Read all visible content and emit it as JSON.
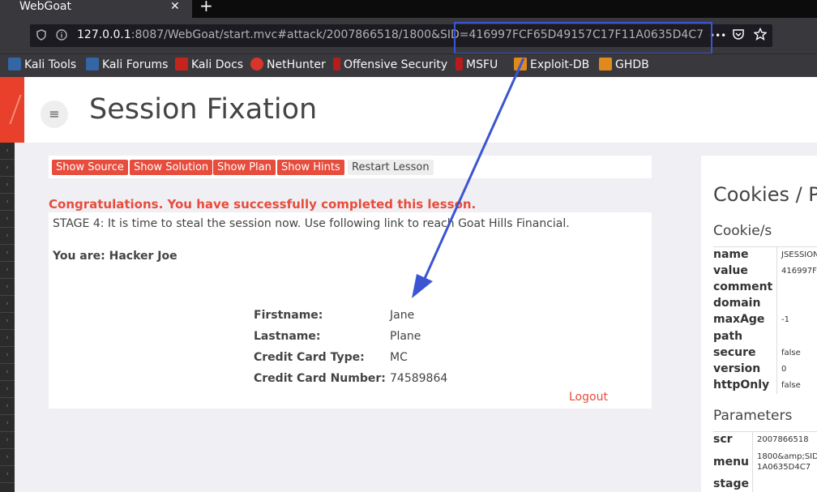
{
  "browser": {
    "tab_title": "WebGoat",
    "tab_close": "✕",
    "new_tab": "+",
    "url_host": "127.0.0.1",
    "url_rest": ":8087/WebGoat/start.mvc#attack/2007866518/1800&SID",
    "url_highlight": "=416997FCF65D49157C17F11A0635D4C7",
    "url_more": "•••",
    "bookmarks": [
      {
        "label": "Kali Tools",
        "icon": "kali-dragon-icon"
      },
      {
        "label": "Kali Forums",
        "icon": "kali-dragon-icon"
      },
      {
        "label": "Kali Docs",
        "icon": "kali-docs-icon"
      },
      {
        "label": "NetHunter",
        "icon": "nethunter-icon"
      },
      {
        "label": "Offensive Security",
        "icon": "offsec-icon"
      },
      {
        "label": "MSFU",
        "icon": "offsec-icon"
      },
      {
        "label": "Exploit-DB",
        "icon": "exploitdb-icon"
      },
      {
        "label": "GHDB",
        "icon": "exploitdb-icon"
      }
    ]
  },
  "header": {
    "menu_icon": "≡",
    "title": "Session Fixation"
  },
  "toolbar": {
    "show_source": "Show Source",
    "show_solution": "Show Solution",
    "show_plan": "Show Plan",
    "show_hints": "Show Hints",
    "restart": "Restart Lesson"
  },
  "lesson": {
    "congrats": "Congratulations. You have successfully completed this lesson.",
    "stage": "STAGE 4: It is time to steal the session now. Use following link to reach Goat Hills Financial.",
    "you_are": "You are: Hacker Joe",
    "fields": [
      {
        "label": "Firstname:",
        "value": "Jane"
      },
      {
        "label": "Lastname:",
        "value": "Plane"
      },
      {
        "label": "Credit Card Type:",
        "value": "MC"
      },
      {
        "label": "Credit Card Number:",
        "value": "74589864"
      }
    ],
    "logout": "Logout"
  },
  "side": {
    "title": "Cookies / Pa",
    "cookies_heading": "Cookie/s",
    "cookies": [
      {
        "k": "name",
        "v": "JSESSION"
      },
      {
        "k": "value",
        "v": "416997F"
      },
      {
        "k": "comment",
        "v": ""
      },
      {
        "k": "domain",
        "v": ""
      },
      {
        "k": "maxAge",
        "v": "-1"
      },
      {
        "k": "path",
        "v": ""
      },
      {
        "k": "secure",
        "v": "false"
      },
      {
        "k": "version",
        "v": "0"
      },
      {
        "k": "httpOnly",
        "v": "false"
      }
    ],
    "params_heading": "Parameters",
    "params": [
      {
        "k": "scr",
        "v": "2007866518"
      },
      {
        "k": "menu",
        "v": "1800&amp;SID",
        "v2": "1A0635D4C7"
      },
      {
        "k": "stage",
        "v": ""
      }
    ]
  },
  "colors": {
    "accent_red": "#e74c3c",
    "annotation_blue": "#3b55d2",
    "chrome_dark": "#38383d"
  }
}
